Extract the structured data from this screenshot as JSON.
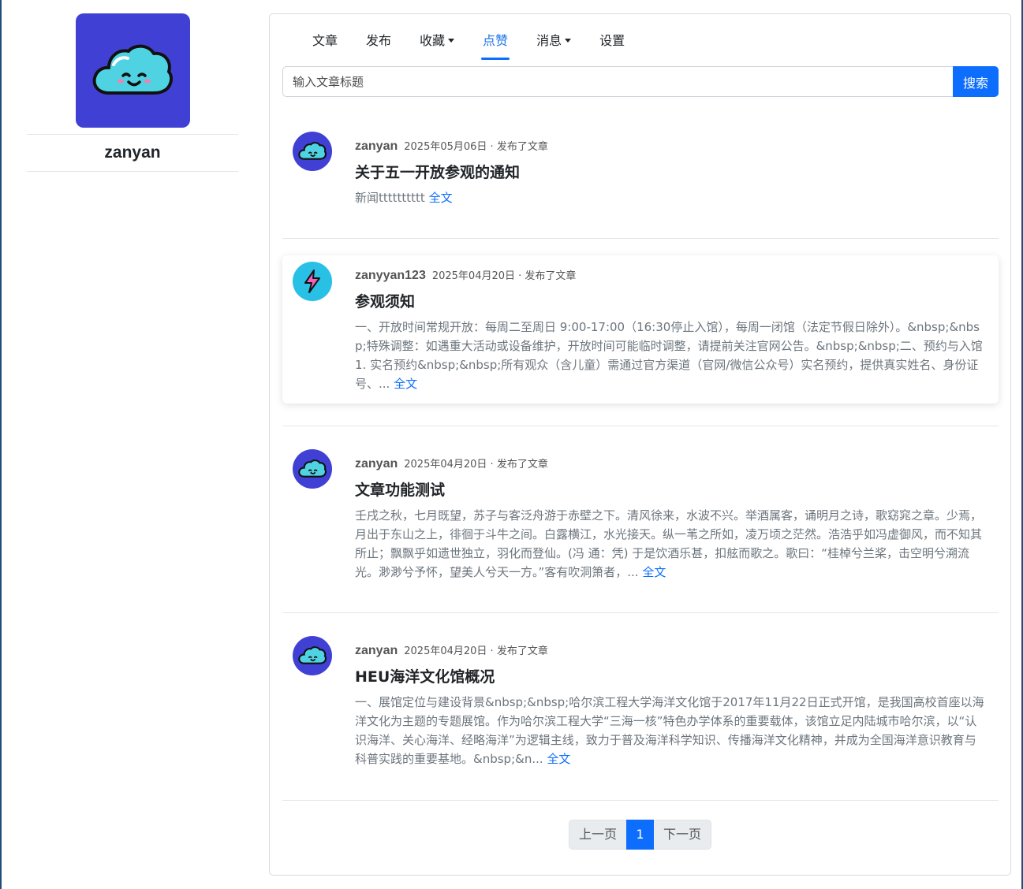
{
  "profile": {
    "name": "zanyan",
    "avatar_icon": "cloud-icon",
    "avatar_bg": "#4040d4"
  },
  "nav": {
    "items": [
      {
        "label": "文章",
        "dropdown": false,
        "active": false
      },
      {
        "label": "发布",
        "dropdown": false,
        "active": false
      },
      {
        "label": "收藏",
        "dropdown": true,
        "active": false
      },
      {
        "label": "点赞",
        "dropdown": false,
        "active": true
      },
      {
        "label": "消息",
        "dropdown": true,
        "active": false
      },
      {
        "label": "设置",
        "dropdown": false,
        "active": false
      }
    ]
  },
  "search": {
    "placeholder": "输入文章标题",
    "value": "",
    "button_label": "搜索"
  },
  "posts": [
    {
      "author": "zanyan",
      "date": "2025年05月06日 · 发布了文章",
      "title": "关于五一开放参观的通知",
      "excerpt": "新闻tttttttttt",
      "more_label": "全文",
      "avatar_icon": "cloud-icon"
    },
    {
      "author": "zanyyan123",
      "date": "2025年04月20日 · 发布了文章",
      "title": "参观须知",
      "excerpt": "一、开放时间常规开放：每周二至周日 9:00-17:00（16:30停止入馆），每周一闭馆（法定节假日除外）。&nbsp;&nbsp;特殊调整：如遇重大活动或设备维护，开放时间可能临时调整，请提前关注官网公告。&nbsp;&nbsp;二、预约与入馆1. 实名预约&nbsp;&nbsp;所有观众（含儿童）需通过官方渠道（官网/微信公众号）实名预约，提供真实姓名、身份证号、... ",
      "more_label": "全文",
      "avatar_icon": "lightning-icon"
    },
    {
      "author": "zanyan",
      "date": "2025年04月20日 · 发布了文章",
      "title": "文章功能测试",
      "excerpt": "壬戌之秋，七月既望，苏子与客泛舟游于赤壁之下。清风徐来，水波不兴。举酒属客，诵明月之诗，歌窈窕之章。少焉，月出于东山之上，徘徊于斗牛之间。白露横江，水光接天。纵一苇之所如，凌万顷之茫然。浩浩乎如冯虚御风，而不知其所止；飘飘乎如遗世独立，羽化而登仙。(冯 通：凭) 于是饮酒乐甚，扣舷而歌之。歌曰：“桂棹兮兰桨，击空明兮溯流光。渺渺兮予怀，望美人兮天一方。”客有吹洞箫者，... ",
      "more_label": "全文",
      "avatar_icon": "cloud-icon"
    },
    {
      "author": "zanyan",
      "date": "2025年04月20日 · 发布了文章",
      "title": "HEU海洋文化馆概况",
      "excerpt": "一、展馆定位与建设背景&nbsp;&nbsp;哈尔滨工程大学海洋文化馆于2017年11月22日正式开馆，是我国高校首座以海洋文化为主题的专题展馆。作为哈尔滨工程大学“三海一核”特色办学体系的重要载体，该馆立足内陆城市哈尔滨，以“认识海洋、关心海洋、经略海洋”为逻辑主线，致力于普及海洋科学知识、传播海洋文化精神，并成为全国海洋意识教育与科普实践的重要基地。&nbsp;&n... ",
      "more_label": "全文",
      "avatar_icon": "cloud-icon"
    }
  ],
  "pagination": {
    "prev_label": "上一页",
    "current": "1",
    "next_label": "下一页"
  },
  "colors": {
    "accent": "#0d6efd",
    "cloud_avatar_bg": "#4040d4",
    "lightning_avatar_bg": "#29c0e6"
  }
}
